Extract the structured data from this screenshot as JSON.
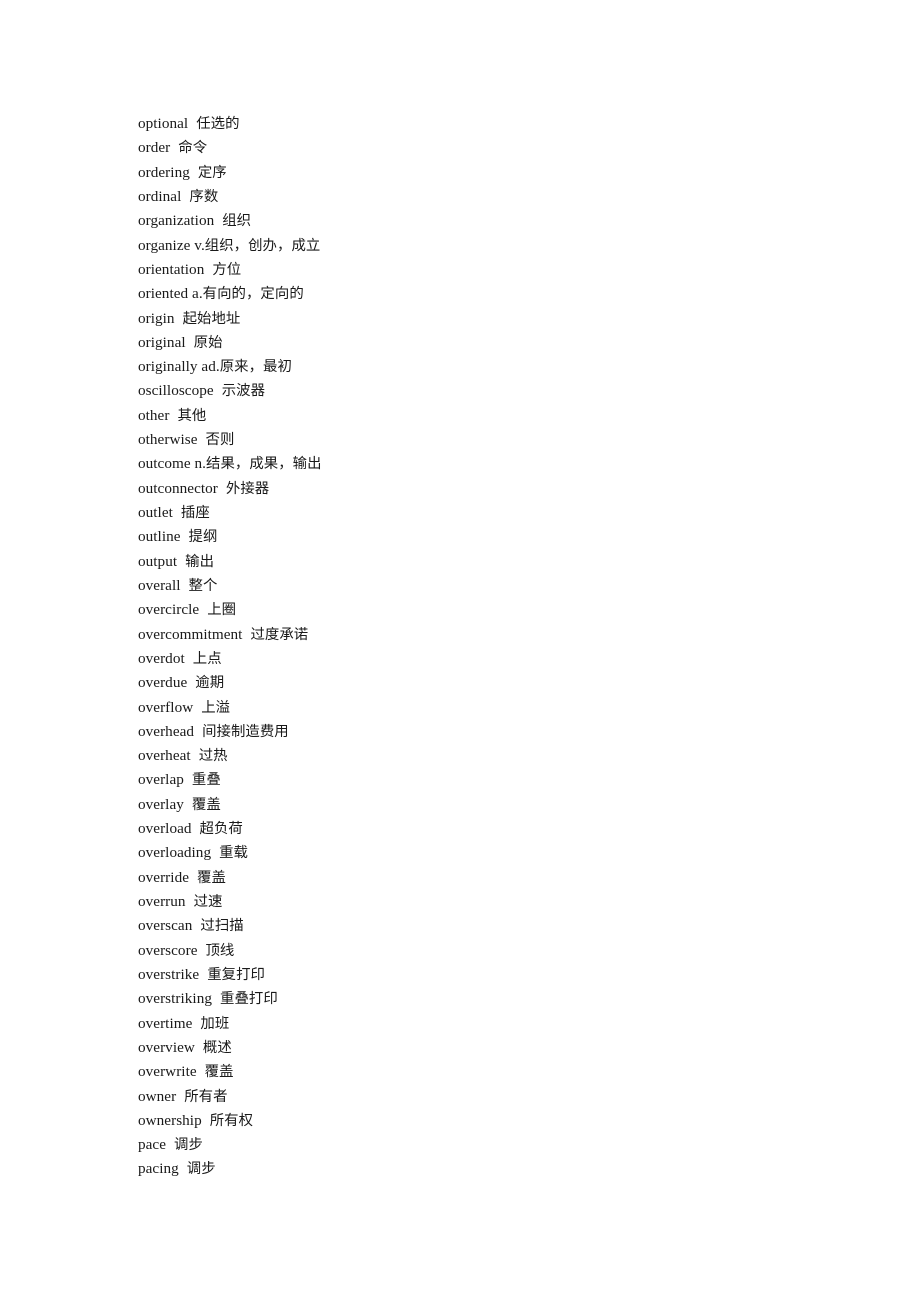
{
  "document": {
    "type": "glossary-page",
    "language_pair": "English-Chinese",
    "background_color": "#ffffff",
    "text_color": "#1a1a1a",
    "entries": [
      {
        "term": "optional",
        "pos": "",
        "gloss": "任选的"
      },
      {
        "term": "order",
        "pos": "",
        "gloss": "命令"
      },
      {
        "term": "ordering",
        "pos": "",
        "gloss": "定序"
      },
      {
        "term": "ordinal",
        "pos": "",
        "gloss": "序数"
      },
      {
        "term": "organization",
        "pos": "",
        "gloss": "组织"
      },
      {
        "term": "organize",
        "pos": "v.",
        "gloss": "组织，创办，成立"
      },
      {
        "term": "orientation",
        "pos": "",
        "gloss": "方位"
      },
      {
        "term": "oriented",
        "pos": "a.",
        "gloss": "有向的，定向的"
      },
      {
        "term": "origin",
        "pos": "",
        "gloss": "起始地址"
      },
      {
        "term": "original",
        "pos": "",
        "gloss": "原始"
      },
      {
        "term": "originally",
        "pos": "ad.",
        "gloss": "原来，最初"
      },
      {
        "term": "oscilloscope",
        "pos": "",
        "gloss": "示波器"
      },
      {
        "term": "other",
        "pos": "",
        "gloss": "其他"
      },
      {
        "term": "otherwise",
        "pos": "",
        "gloss": "否则"
      },
      {
        "term": "outcome",
        "pos": "n.",
        "gloss": "结果，成果，输出"
      },
      {
        "term": "outconnector",
        "pos": "",
        "gloss": "外接器"
      },
      {
        "term": "outlet",
        "pos": "",
        "gloss": "插座"
      },
      {
        "term": "outline",
        "pos": "",
        "gloss": "提纲"
      },
      {
        "term": "output",
        "pos": "",
        "gloss": "输出"
      },
      {
        "term": "overall",
        "pos": "",
        "gloss": "整个"
      },
      {
        "term": "overcircle",
        "pos": "",
        "gloss": "上圈"
      },
      {
        "term": "overcommitment",
        "pos": "",
        "gloss": "过度承诺"
      },
      {
        "term": "overdot",
        "pos": "",
        "gloss": "上点"
      },
      {
        "term": "overdue",
        "pos": "",
        "gloss": "逾期"
      },
      {
        "term": "overflow",
        "pos": "",
        "gloss": "上溢"
      },
      {
        "term": "overhead",
        "pos": "",
        "gloss": "间接制造费用"
      },
      {
        "term": "overheat",
        "pos": "",
        "gloss": "过热"
      },
      {
        "term": "overlap",
        "pos": "",
        "gloss": "重叠"
      },
      {
        "term": "overlay",
        "pos": "",
        "gloss": "覆盖"
      },
      {
        "term": "overload",
        "pos": "",
        "gloss": "超负荷"
      },
      {
        "term": "overloading",
        "pos": "",
        "gloss": "重载"
      },
      {
        "term": "override",
        "pos": "",
        "gloss": "覆盖"
      },
      {
        "term": "overrun",
        "pos": "",
        "gloss": "过速"
      },
      {
        "term": "overscan",
        "pos": "",
        "gloss": "过扫描"
      },
      {
        "term": "overscore",
        "pos": "",
        "gloss": "顶线"
      },
      {
        "term": "overstrike",
        "pos": "",
        "gloss": "重复打印"
      },
      {
        "term": "overstriking",
        "pos": "",
        "gloss": "重叠打印"
      },
      {
        "term": "overtime",
        "pos": "",
        "gloss": "加班"
      },
      {
        "term": "overview",
        "pos": "",
        "gloss": "概述"
      },
      {
        "term": "overwrite",
        "pos": "",
        "gloss": "覆盖"
      },
      {
        "term": "owner",
        "pos": "",
        "gloss": "所有者"
      },
      {
        "term": "ownership",
        "pos": "",
        "gloss": "所有权"
      },
      {
        "term": "pace",
        "pos": "",
        "gloss": "调步"
      },
      {
        "term": "pacing",
        "pos": "",
        "gloss": "调步"
      }
    ]
  }
}
